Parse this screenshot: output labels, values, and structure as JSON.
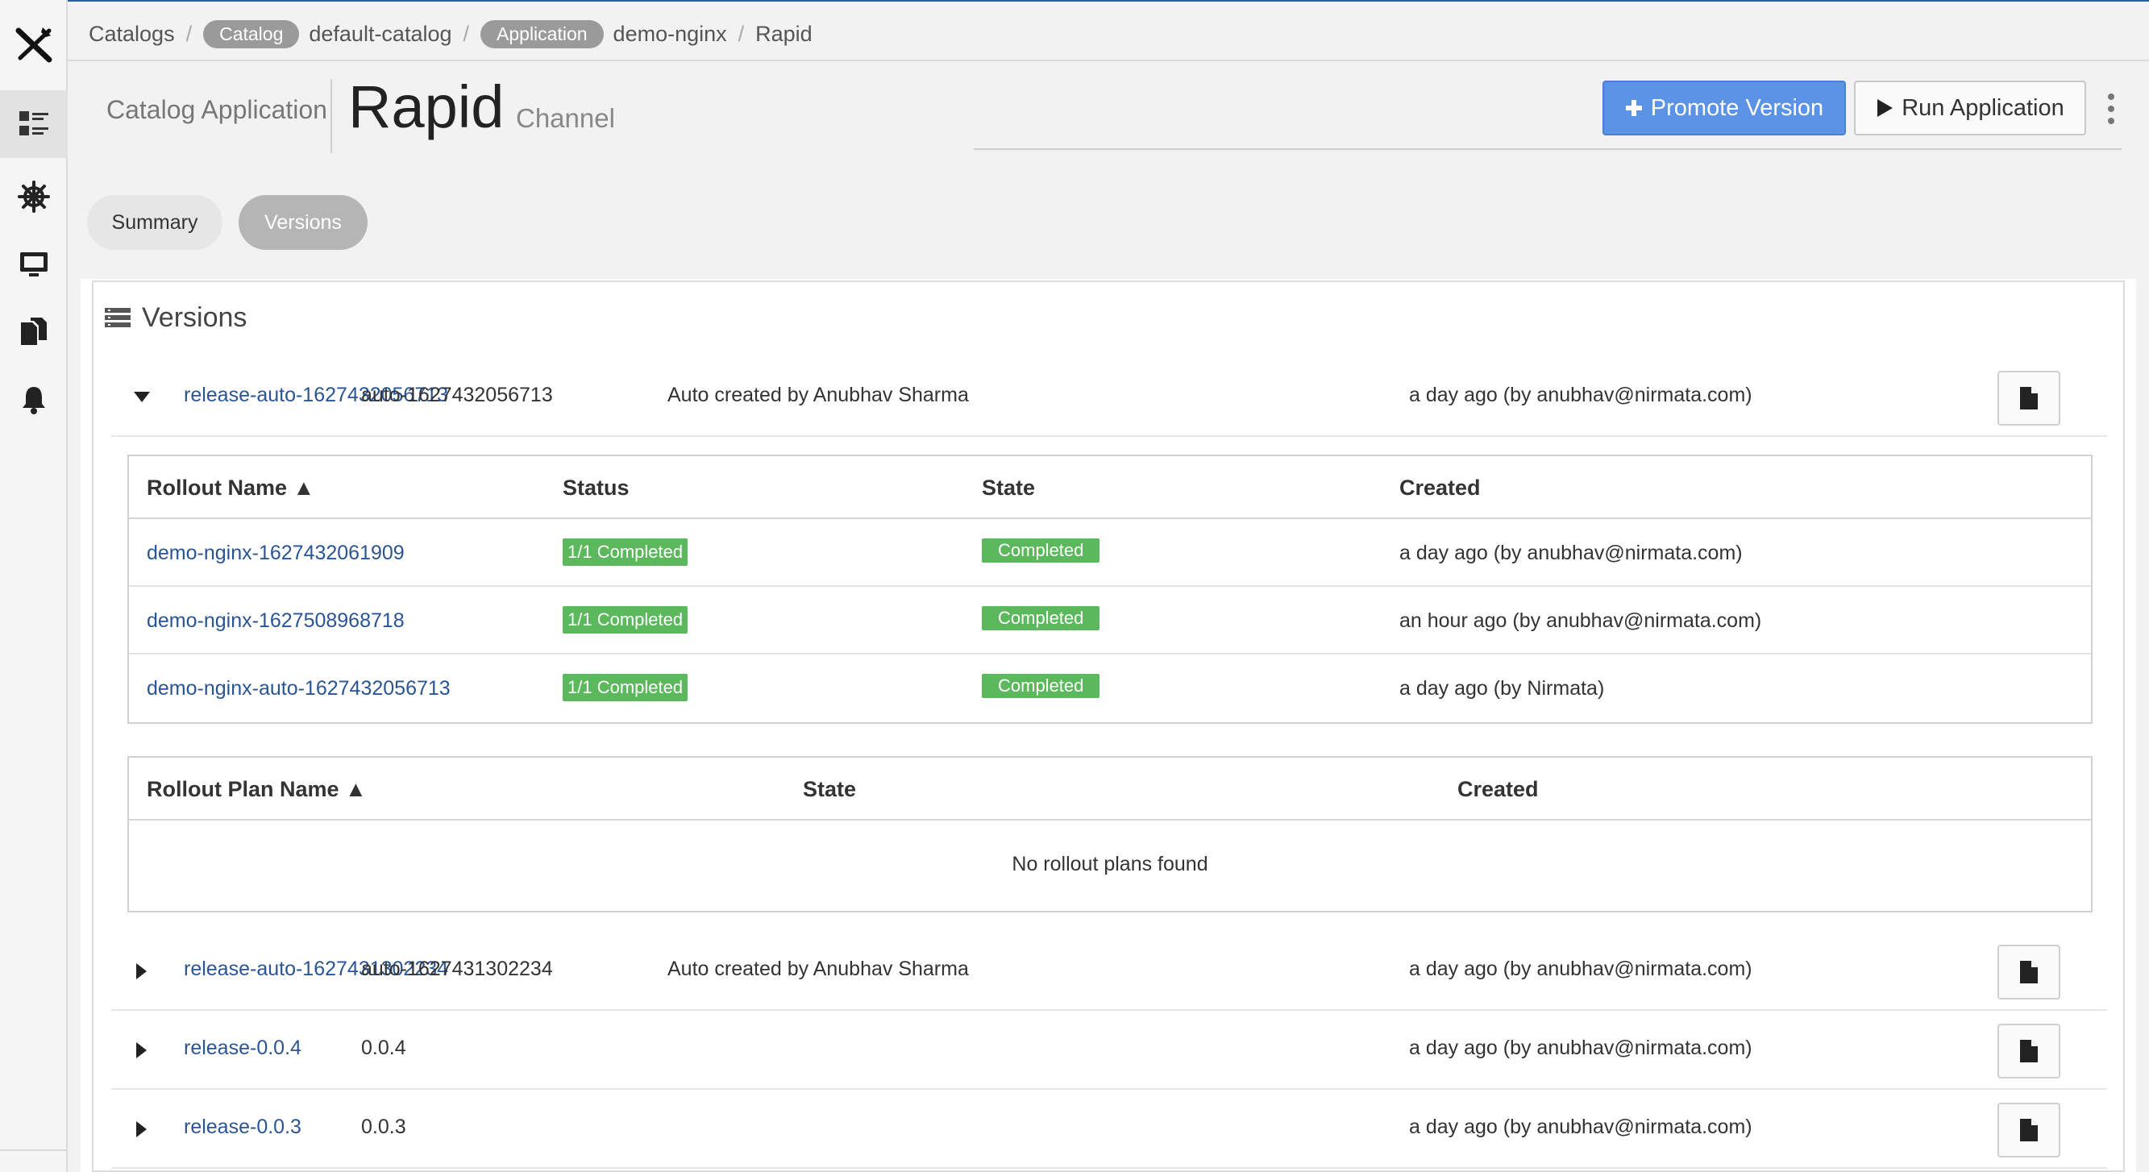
{
  "breadcrumb": {
    "root": "Catalogs",
    "catalog_badge": "Catalog",
    "catalog_name": "default-catalog",
    "app_badge": "Application",
    "app_name": "demo-nginx",
    "current": "Rapid"
  },
  "header": {
    "subtitle": "Catalog Application",
    "title": "Rapid",
    "kind": "Channel"
  },
  "actions": {
    "promote_label": "Promote Version",
    "run_label": "Run Application"
  },
  "tabs": [
    {
      "label": "Summary",
      "active": false
    },
    {
      "label": "Versions",
      "active": true
    }
  ],
  "panel": {
    "title": "Versions"
  },
  "versions": [
    {
      "name": "release-auto-1627432056713",
      "tag": "auto-1627432056713",
      "description": "Auto created by Anubhav Sharma",
      "created": "a day ago (by anubhav@nirmata.com)",
      "expanded": true
    },
    {
      "name": "release-auto-1627431302234",
      "tag": "auto-1627431302234",
      "description": "Auto created by Anubhav Sharma",
      "created": "a day ago (by anubhav@nirmata.com)",
      "expanded": false
    },
    {
      "name": "release-0.0.4",
      "tag": "0.0.4",
      "description": "",
      "created": "a day ago (by anubhav@nirmata.com)",
      "expanded": false
    },
    {
      "name": "release-0.0.3",
      "tag": "0.0.3",
      "description": "",
      "created": "a day ago (by anubhav@nirmata.com)",
      "expanded": false
    }
  ],
  "rollouts": {
    "headers": {
      "name": "Rollout Name ▲",
      "status": "Status",
      "state": "State",
      "created": "Created"
    },
    "rows": [
      {
        "name": "demo-nginx-1627432061909",
        "status": "1/1 Completed",
        "state": "Completed",
        "created": "a day ago (by anubhav@nirmata.com)"
      },
      {
        "name": "demo-nginx-1627508968718",
        "status": "1/1 Completed",
        "state": "Completed",
        "created": "an hour ago (by anubhav@nirmata.com)"
      },
      {
        "name": "demo-nginx-auto-1627432056713",
        "status": "1/1 Completed",
        "state": "Completed",
        "created": "a day ago (by Nirmata)"
      }
    ]
  },
  "rollout_plans": {
    "headers": {
      "name": "Rollout Plan Name ▲",
      "state": "State",
      "created": "Created"
    },
    "empty_text": "No rollout plans found"
  },
  "colors": {
    "primary": "#5b93e6",
    "link": "#2a5592",
    "success": "#5cb85c"
  }
}
